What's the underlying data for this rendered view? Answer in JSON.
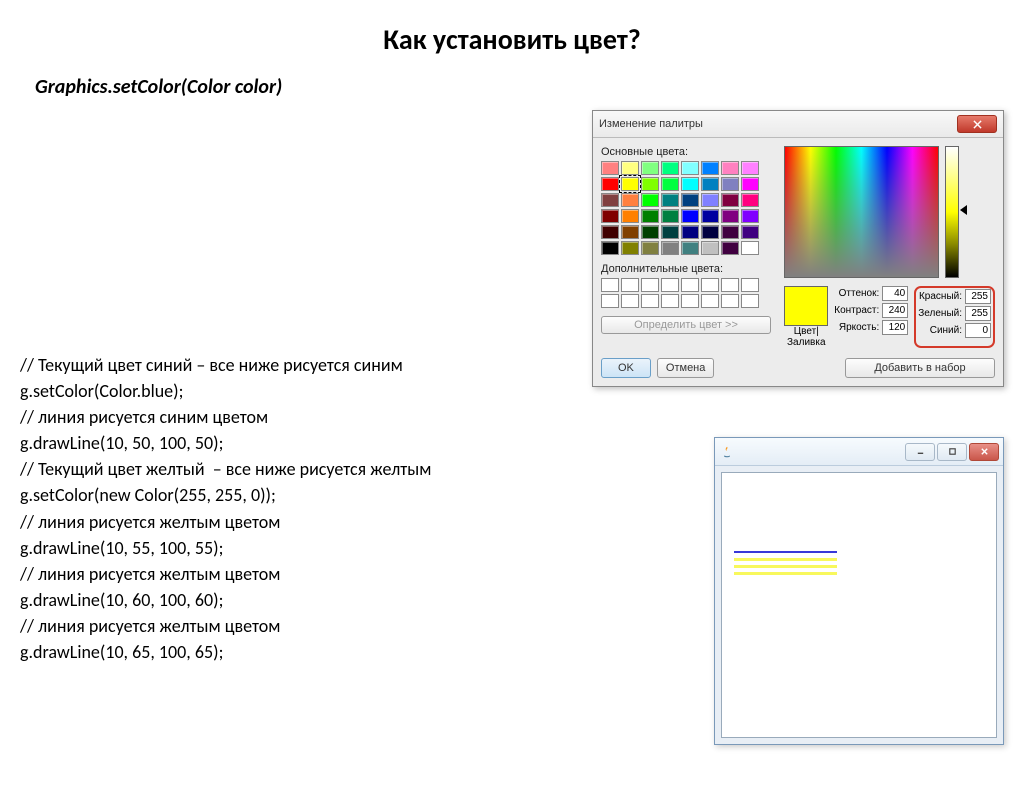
{
  "title": "Как установить цвет?",
  "method": "Graphics.setColor(Color color)",
  "code": [
    "// Текущий цвет синий – все ниже рисуется синим",
    "g.setColor(Color.blue);",
    "// линия рисуется синим цветом",
    "g.drawLine(10, 50, 100, 50);",
    "// Текущий цвет желтый  – все ниже рисуется желтым",
    "g.setColor(new Color(255, 255, 0));",
    "// линия рисуется желтым цветом",
    "g.drawLine(10, 55, 100, 55);",
    "// линия рисуется желтым цветом",
    "g.drawLine(10, 60, 100, 60);",
    "// линия рисуется желтым цветом",
    "g.drawLine(10, 65, 100, 65);"
  ],
  "colorDialog": {
    "title": "Изменение палитры",
    "basicColorsLabel": "Основные цвета:",
    "customColorsLabel": "Дополнительные цвета:",
    "defineBtn": "Определить цвет >>",
    "okBtn": "OK",
    "cancelBtn": "Отмена",
    "addBtn": "Добавить в набор",
    "previewLabel": "Цвет|Заливка",
    "hsl": {
      "hueLabel": "Оттенок:",
      "hue": "40",
      "satLabel": "Контраст:",
      "sat": "240",
      "lumLabel": "Яркость:",
      "lum": "120"
    },
    "rgb": {
      "rLabel": "Красный:",
      "r": "255",
      "gLabel": "Зеленый:",
      "g": "255",
      "bLabel": "Синий:",
      "b": "0"
    },
    "basicColors": [
      "#ff8080",
      "#ffff80",
      "#80ff80",
      "#00ff80",
      "#80ffff",
      "#0080ff",
      "#ff80c0",
      "#ff80ff",
      "#ff0000",
      "#ffff00",
      "#80ff00",
      "#00ff40",
      "#00ffff",
      "#0080c0",
      "#8080c0",
      "#ff00ff",
      "#804040",
      "#ff8040",
      "#00ff00",
      "#008080",
      "#004080",
      "#8080ff",
      "#800040",
      "#ff0080",
      "#800000",
      "#ff8000",
      "#008000",
      "#008040",
      "#0000ff",
      "#0000a0",
      "#800080",
      "#8000ff",
      "#400000",
      "#804000",
      "#004000",
      "#004040",
      "#000080",
      "#000040",
      "#400040",
      "#400080",
      "#000000",
      "#808000",
      "#808040",
      "#808080",
      "#408080",
      "#c0c0c0",
      "#400040",
      "#ffffff"
    ],
    "selectedIndex": 9
  }
}
